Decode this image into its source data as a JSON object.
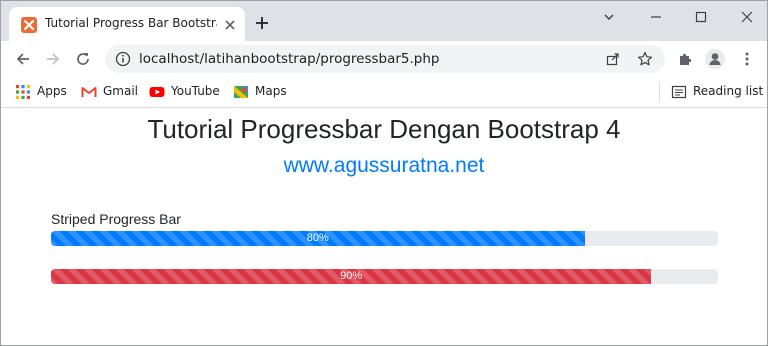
{
  "browser": {
    "tab_title": "Tutorial Progress Bar Bootstrap 4",
    "url": "localhost/latihanbootstrap/progressbar5.php"
  },
  "bookmarks": {
    "items": [
      {
        "label": "Apps",
        "icon": "apps-grid-icon"
      },
      {
        "label": "Gmail",
        "icon": "gmail-icon"
      },
      {
        "label": "YouTube",
        "icon": "youtube-icon"
      },
      {
        "label": "Maps",
        "icon": "maps-icon"
      }
    ],
    "reading_list": "Reading list"
  },
  "page": {
    "title": "Tutorial Progressbar Dengan Bootstrap 4",
    "subtitle": "www.agussuratna.net",
    "section_label": "Striped Progress Bar",
    "bars": [
      {
        "value": 0.8,
        "label": "80%",
        "color": "#007bff"
      },
      {
        "value": 0.9,
        "label": "90%",
        "color": "#dc3545"
      }
    ]
  },
  "colors": {
    "tabstrip": "#dee1e6",
    "link": "#007bff",
    "track": "#e9ecef"
  }
}
